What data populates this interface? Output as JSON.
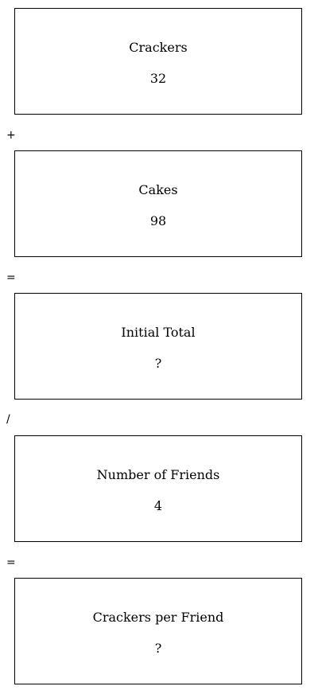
{
  "boxes": [
    {
      "label": "Crackers",
      "value": "32"
    },
    {
      "label": "Cakes",
      "value": "98"
    },
    {
      "label": "Initial Total",
      "value": "?"
    },
    {
      "label": "Number of Friends",
      "value": "4"
    },
    {
      "label": "Crackers per Friend",
      "value": "?"
    }
  ],
  "operators": [
    "+",
    "=",
    "/",
    "="
  ]
}
